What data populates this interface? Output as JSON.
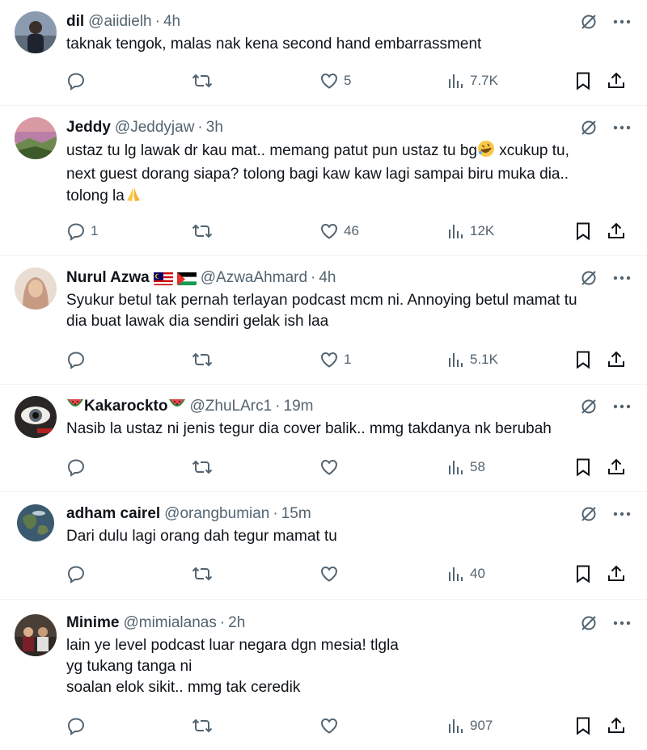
{
  "tweets": [
    {
      "name": "dil",
      "handle": "@aiidielh",
      "time": "4h",
      "lines": [
        "taknak tengok, malas nak kena second hand embarrassment"
      ],
      "replies": "",
      "likes": "5",
      "views": "7.7K"
    },
    {
      "name": "Jeddy",
      "handle": "@Jeddyjaw",
      "time": "3h",
      "lines": [
        "ustaz tu lg lawak dr kau mat..  memang patut pun ustaz tu bg",
        "next guest dorang siapa? tolong bagi kaw kaw lagi sampai biru muka dia..",
        "tolong la"
      ],
      "line1_tail": "xcukup tu,",
      "replies": "1",
      "likes": "46",
      "views": "12K"
    },
    {
      "name": "Nurul Azwa",
      "handle": "@AzwaAhmard",
      "time": "4h",
      "lines": [
        "Syukur betul tak pernah terlayan podcast mcm ni. Annoying betul mamat tu",
        "dia buat lawak dia sendiri gelak ish laa"
      ],
      "replies": "",
      "likes": "1",
      "views": "5.1K"
    },
    {
      "name": "Kakarockto",
      "handle": "@ZhuLArc1",
      "time": "19m",
      "lines": [
        "Nasib la ustaz ni jenis tegur dia cover balik.. mmg takdanya nk berubah"
      ],
      "replies": "",
      "likes": "",
      "views": "58"
    },
    {
      "name": "adham cairel",
      "handle": "@orangbumian",
      "time": "15m",
      "lines": [
        "Dari dulu lagi orang dah tegur mamat tu"
      ],
      "replies": "",
      "likes": "",
      "views": "40"
    },
    {
      "name": "Minime",
      "handle": "@mimialanas",
      "time": "2h",
      "lines": [
        "lain ye level podcast luar negara dgn mesia! tlgla",
        "yg tukang tanga ni",
        "soalan elok sikit.. mmg tak ceredik"
      ],
      "replies": "",
      "likes": "",
      "views": "907"
    }
  ],
  "colors": {
    "text": "#0f1419",
    "muted": "#536471",
    "divider": "#eff3f4"
  },
  "icons": [
    "grok-slash-icon",
    "more-icon",
    "reply-icon",
    "retweet-icon",
    "like-icon",
    "views-icon",
    "bookmark-icon",
    "share-icon"
  ]
}
